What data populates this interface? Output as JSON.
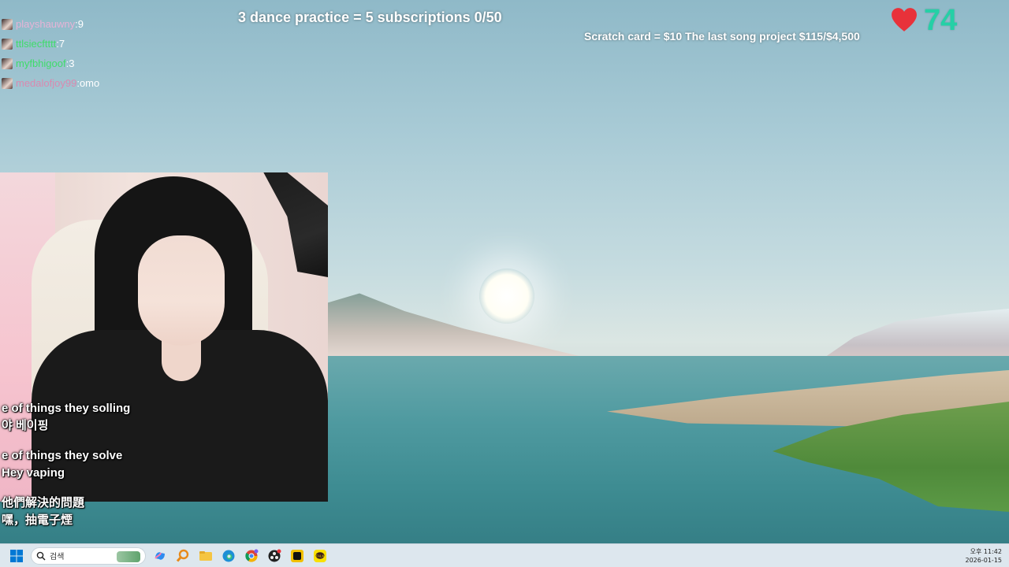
{
  "overlay": {
    "goal_text": "3 dance practice = 5 subscriptions 0/50",
    "project_text": "Scratch card = $10 The last song project $115/$4,500",
    "heart_count": "74",
    "heart_color": "#e8323a",
    "count_color": "#25d0a6"
  },
  "chat": {
    "messages": [
      {
        "user": "playshauwny",
        "separator": ":",
        "text": "9",
        "user_color": "#e6b3d6"
      },
      {
        "user": "ttlsiecftttt",
        "separator": ":",
        "text": "7",
        "user_color": "#3fdc6a"
      },
      {
        "user": "myfbhigoof",
        "separator": ":",
        "text": "3",
        "user_color": "#3fdc6a"
      },
      {
        "user": "medalofjoy99",
        "separator": ":",
        "text": "omo",
        "user_color": "#d98ab0"
      }
    ]
  },
  "subtitles": {
    "block1": [
      "e of things they solling",
      "야 베이핑"
    ],
    "block2": [
      "e of things they solve",
      "Hey vaping"
    ],
    "block3": [
      "他們解決的問題",
      "嘿，抽電子煙"
    ]
  },
  "taskbar": {
    "search_placeholder": "검색",
    "apps": [
      "copilot-icon",
      "magnifier-app-icon",
      "file-explorer-icon",
      "edge-icon",
      "chrome-icon",
      "obs-icon",
      "terminal-app-icon",
      "kakaotalk-icon"
    ],
    "clock_time": "오후 11:42",
    "clock_date": "2026-01-15"
  }
}
